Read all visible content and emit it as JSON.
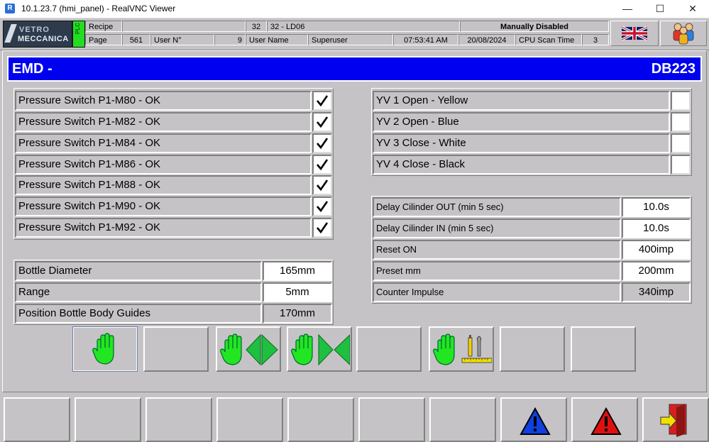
{
  "window": {
    "title": "10.1.23.7 (hmi_panel) - RealVNC Viewer",
    "app_icon": "R",
    "controls": {
      "minimize": "—",
      "maximize": "☐",
      "close": "✕"
    }
  },
  "header": {
    "logo": {
      "line1": "VETRO",
      "line2": "MECCANICA"
    },
    "plc_label": "PLC",
    "recipe_label": "Recipe",
    "recipe_value": "",
    "recipe_number": "32",
    "recipe_name": "32 - LD06",
    "status": "Manually Disabled",
    "page_label": "Page",
    "page_value": "561",
    "user_no_label": "User N°",
    "user_no_value": "9",
    "user_name_label": "User Name",
    "user_name_value": "Superuser",
    "time": "07:53:41 AM",
    "date": "20/08/2024",
    "scan_label": "CPU Scan Time",
    "scan_value": "3",
    "language_icon": "uk-flag-icon",
    "users_icon": "users-icon"
  },
  "banner": {
    "title": "EMD -",
    "db": "DB223"
  },
  "pressure_switches": [
    {
      "label": "Pressure Switch P1-M80 - OK",
      "checked": true
    },
    {
      "label": "Pressure Switch P1-M82 - OK",
      "checked": true
    },
    {
      "label": "Pressure Switch P1-M84 - OK",
      "checked": true
    },
    {
      "label": "Pressure Switch P1-M86 - OK",
      "checked": true
    },
    {
      "label": "Pressure Switch P1-M88 - OK",
      "checked": true
    },
    {
      "label": "Pressure Switch P1-M90 - OK",
      "checked": true
    },
    {
      "label": "Pressure Switch P1-M92 - OK",
      "checked": true
    }
  ],
  "valves": [
    {
      "label": "YV 1 Open - Yellow",
      "checked": false
    },
    {
      "label": "YV 2 Open - Blue",
      "checked": false
    },
    {
      "label": "YV 3 Close - White",
      "checked": false
    },
    {
      "label": "YV 4 Close - Black",
      "checked": false
    }
  ],
  "bottle": [
    {
      "label": "Bottle Diameter",
      "value": "165mm",
      "editable": true
    },
    {
      "label": "Range",
      "value": "5mm",
      "editable": true
    },
    {
      "label": "Position Bottle Body Guides",
      "value": "170mm",
      "editable": false
    }
  ],
  "params": [
    {
      "label": "Delay Cilinder OUT (min 5 sec)",
      "value": "10.0s",
      "editable": true
    },
    {
      "label": "Delay Cilinder IN (min 5 sec)",
      "value": "10.0s",
      "editable": true
    },
    {
      "label": "Reset ON",
      "value": "400imp",
      "editable": true
    },
    {
      "label": "Preset mm",
      "value": "200mm",
      "editable": true
    },
    {
      "label": "Counter Impulse",
      "value": "340imp",
      "editable": false
    }
  ],
  "actions": [
    "manual-hand-icon",
    "empty",
    "hand-open-arrows-icon",
    "hand-close-arrows-icon",
    "empty",
    "hand-tools-icon",
    "empty",
    "empty"
  ],
  "footer": [
    "empty",
    "empty",
    "empty",
    "empty",
    "empty",
    "empty",
    "empty",
    "blue-warning-icon",
    "red-alarm-icon",
    "exit-door-icon"
  ],
  "colors": {
    "banner": "#0000f0",
    "panel": "#c6c3c6",
    "hand": "#22e622",
    "plc": "#22dd22"
  }
}
